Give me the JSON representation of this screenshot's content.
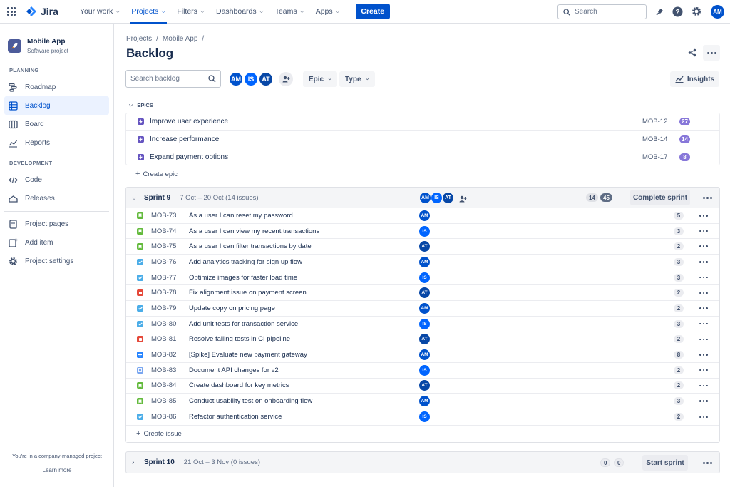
{
  "topbar": {
    "product": "Jira",
    "nav": [
      {
        "label": "Your work",
        "active": false
      },
      {
        "label": "Projects",
        "active": true
      },
      {
        "label": "Filters",
        "active": false
      },
      {
        "label": "Dashboards",
        "active": false
      },
      {
        "label": "Teams",
        "active": false
      },
      {
        "label": "Apps",
        "active": false
      }
    ],
    "create_label": "Create",
    "search_placeholder": "Search",
    "user_initials": "AM"
  },
  "sidebar": {
    "project_name": "Mobile App",
    "project_type": "Software project",
    "planning_label": "PLANNING",
    "planning_items": [
      {
        "label": "Roadmap",
        "icon": "roadmap-icon"
      },
      {
        "label": "Backlog",
        "icon": "backlog-icon",
        "active": true
      },
      {
        "label": "Board",
        "icon": "board-icon"
      },
      {
        "label": "Reports",
        "icon": "reports-icon"
      }
    ],
    "development_label": "DEVELOPMENT",
    "development_items": [
      {
        "label": "Code",
        "icon": "code-icon"
      },
      {
        "label": "Releases",
        "icon": "releases-icon"
      }
    ],
    "other_items": [
      {
        "label": "Project pages",
        "icon": "pages-icon"
      },
      {
        "label": "Add item",
        "icon": "add-item-icon"
      },
      {
        "label": "Project settings",
        "icon": "settings-icon"
      }
    ],
    "footer_text": "You're in a company-managed project",
    "footer_link": "Learn more"
  },
  "header": {
    "breadcrumbs": [
      "Projects",
      "/",
      "Mobile App",
      "/"
    ],
    "title": "Backlog",
    "search_placeholder": "Search backlog",
    "avatars": [
      "AM",
      "IS",
      "AT"
    ],
    "filters": [
      {
        "label": "Epic"
      },
      {
        "label": "Type"
      }
    ],
    "insights_label": "Insights"
  },
  "epics": {
    "heading": "EPICS",
    "items": [
      {
        "name": "Improve user experience",
        "key": "MOB-12",
        "count": "27"
      },
      {
        "name": "Increase performance",
        "key": "MOB-14",
        "count": "14"
      },
      {
        "name": "Expand payment options",
        "key": "MOB-17",
        "count": "8"
      }
    ],
    "create_label": "Create epic"
  },
  "sprint9": {
    "name": "Sprint 9",
    "dates": "7 Oct – 20 Oct (14 issues)",
    "avatars": [
      "AM",
      "IS",
      "AT"
    ],
    "count_todo": "14",
    "count_total": "45",
    "action_label": "Complete sprint",
    "issues": [
      {
        "key": "MOB-73",
        "summary": "As a user I can reset my password",
        "type": "story",
        "assignee": "AM",
        "points": "5"
      },
      {
        "key": "MOB-74",
        "summary": "As a user I can view my recent transactions",
        "type": "story",
        "assignee": "IS",
        "points": "3"
      },
      {
        "key": "MOB-75",
        "summary": "As a user I can filter transactions by date",
        "type": "story",
        "assignee": "AT",
        "points": "2"
      },
      {
        "key": "MOB-76",
        "summary": "Add analytics tracking for sign up flow",
        "type": "task",
        "assignee": "AM",
        "points": "3"
      },
      {
        "key": "MOB-77",
        "summary": "Optimize images for faster load time",
        "type": "task",
        "assignee": "IS",
        "points": "3"
      },
      {
        "key": "MOB-78",
        "summary": "Fix alignment issue on payment screen",
        "type": "bug",
        "assignee": "AT",
        "points": "2"
      },
      {
        "key": "MOB-79",
        "summary": "Update copy on pricing page",
        "type": "task",
        "assignee": "AM",
        "points": "2"
      },
      {
        "key": "MOB-80",
        "summary": "Add unit tests for transaction service",
        "type": "task",
        "assignee": "IS",
        "points": "3"
      },
      {
        "key": "MOB-81",
        "summary": "Resolve failing tests in CI pipeline",
        "type": "bug",
        "assignee": "AT",
        "points": "2"
      },
      {
        "key": "MOB-82",
        "summary": "[Spike] Evaluate new payment gateway",
        "type": "spike",
        "assignee": "AM",
        "points": "8"
      },
      {
        "key": "MOB-83",
        "summary": "Document API changes for v2",
        "type": "doc",
        "assignee": "IS",
        "points": "2"
      },
      {
        "key": "MOB-84",
        "summary": "Create dashboard for key metrics",
        "type": "story",
        "assignee": "AT",
        "points": "2"
      },
      {
        "key": "MOB-85",
        "summary": "Conduct usability test on onboarding flow",
        "type": "story",
        "assignee": "AM",
        "points": "3"
      },
      {
        "key": "MOB-86",
        "summary": "Refactor authentication service",
        "type": "task",
        "assignee": "IS",
        "points": "2"
      }
    ],
    "create_label": "Create issue"
  },
  "sprint10": {
    "name": "Sprint 10",
    "dates": "21 Oct – 3 Nov (0 issues)",
    "count_todo": "0",
    "count_total": "0",
    "action_label": "Start sprint"
  },
  "colors": {
    "primary": "#0052cc",
    "story": "#63ba3c",
    "task": "#4bade8",
    "bug": "#e5493a",
    "spike": "#2684ff",
    "doc": "#7aa7f0",
    "epic": "#6554c0"
  }
}
